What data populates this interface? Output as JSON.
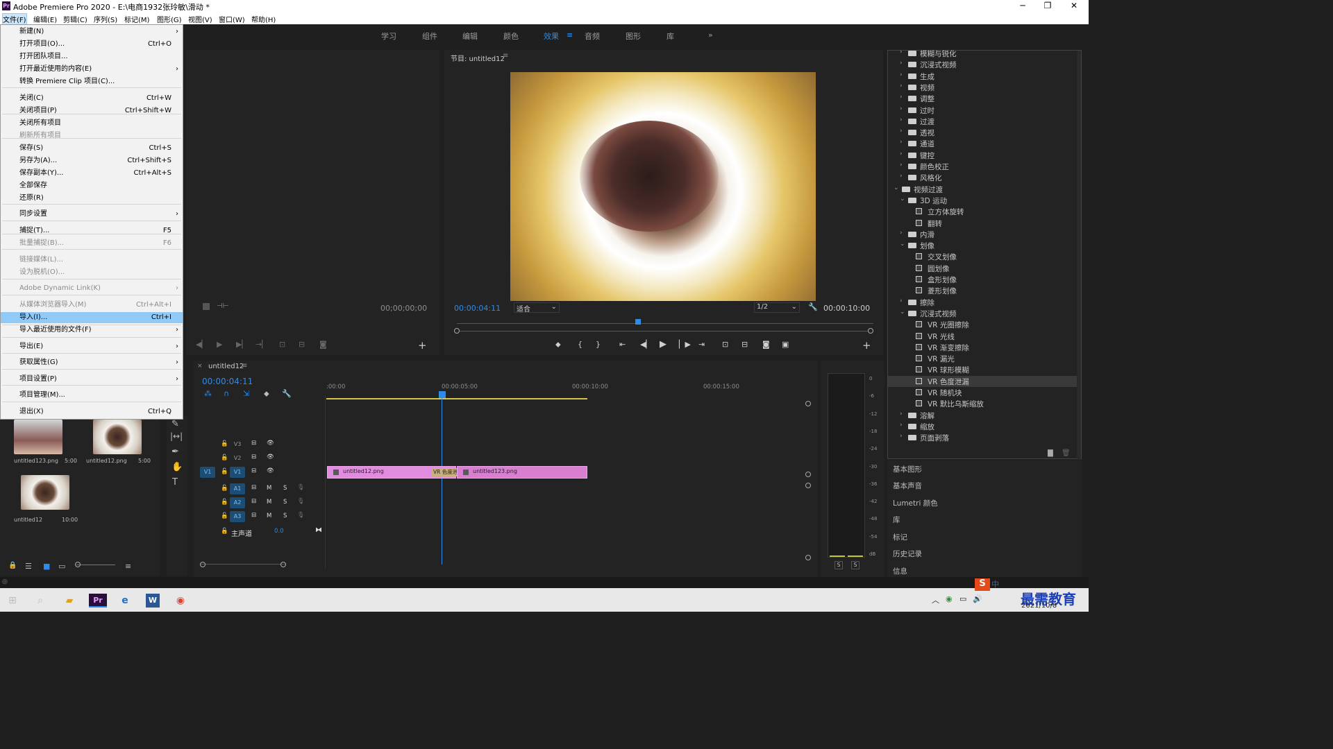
{
  "titlebar": {
    "app_icon": "Pr",
    "title": "Adobe Premiere Pro 2020 - E:\\电商1932张玲敏\\滑动 *"
  },
  "menubar": [
    "文件(F)",
    "编辑(E)",
    "剪辑(C)",
    "序列(S)",
    "标记(M)",
    "图形(G)",
    "视图(V)",
    "窗口(W)",
    "帮助(H)"
  ],
  "workspaces": [
    "学习",
    "组件",
    "编辑",
    "颜色",
    "效果",
    "音频",
    "图形",
    "库"
  ],
  "workspace_more": "»",
  "file_menu": [
    {
      "label": "新建(N)",
      "shortcut": "",
      "arrow": true
    },
    {
      "label": "打开项目(O)...",
      "shortcut": "Ctrl+O"
    },
    {
      "label": "打开团队项目..."
    },
    {
      "label": "打开最近使用的内容(E)",
      "arrow": true
    },
    {
      "label": "转换 Premiere Clip 项目(C)..."
    },
    {
      "label": "关闭(C)",
      "shortcut": "Ctrl+W"
    },
    {
      "label": "关闭项目(P)",
      "shortcut": "Ctrl+Shift+W"
    },
    {
      "label": "关闭所有项目"
    },
    {
      "label": "刷新所有项目",
      "disabled": true
    },
    {
      "label": "保存(S)",
      "shortcut": "Ctrl+S"
    },
    {
      "label": "另存为(A)...",
      "shortcut": "Ctrl+Shift+S"
    },
    {
      "label": "保存副本(Y)...",
      "shortcut": "Ctrl+Alt+S"
    },
    {
      "label": "全部保存"
    },
    {
      "label": "还原(R)"
    },
    {
      "label": "同步设置",
      "arrow": true
    },
    {
      "label": "捕捉(T)...",
      "shortcut": "F5"
    },
    {
      "label": "批量捕捉(B)...",
      "shortcut": "F6",
      "disabled": true
    },
    {
      "label": "链接媒体(L)...",
      "disabled": true
    },
    {
      "label": "设为脱机(O)...",
      "disabled": true
    },
    {
      "label": "Adobe Dynamic Link(K)",
      "arrow": true,
      "disabled": true
    },
    {
      "label": "从媒体浏览器导入(M)",
      "shortcut": "Ctrl+Alt+I",
      "disabled": true
    },
    {
      "label": "导入(I)...",
      "shortcut": "Ctrl+I",
      "highlight": true
    },
    {
      "label": "导入最近使用的文件(F)",
      "arrow": true
    },
    {
      "label": "导出(E)",
      "arrow": true
    },
    {
      "label": "获取属性(G)",
      "arrow": true
    },
    {
      "label": "项目设置(P)",
      "arrow": true
    },
    {
      "label": "项目管理(M)..."
    },
    {
      "label": "退出(X)",
      "shortcut": "Ctrl+Q"
    }
  ],
  "source_monitor": {
    "timecode": "00;00;00;00"
  },
  "program_monitor": {
    "title": "节目: untitled12",
    "timecode": "00:00:04:11",
    "fit": "适合",
    "resolution": "1/2",
    "duration": "00:00:10:00"
  },
  "effects_tree": [
    {
      "label": "模糊与锐化",
      "type": "folder",
      "level": 1,
      "open": false
    },
    {
      "label": "沉浸式视频",
      "type": "folder",
      "level": 1,
      "open": false
    },
    {
      "label": "生成",
      "type": "folder",
      "level": 1,
      "open": false
    },
    {
      "label": "视频",
      "type": "folder",
      "level": 1,
      "open": false
    },
    {
      "label": "调整",
      "type": "folder",
      "level": 1,
      "open": false
    },
    {
      "label": "过时",
      "type": "folder",
      "level": 1,
      "open": false
    },
    {
      "label": "过渡",
      "type": "folder",
      "level": 1,
      "open": false
    },
    {
      "label": "透视",
      "type": "folder",
      "level": 1,
      "open": false
    },
    {
      "label": "通道",
      "type": "folder",
      "level": 1,
      "open": false
    },
    {
      "label": "键控",
      "type": "folder",
      "level": 1,
      "open": false
    },
    {
      "label": "颜色校正",
      "type": "folder",
      "level": 1,
      "open": false
    },
    {
      "label": "风格化",
      "type": "folder",
      "level": 1,
      "open": false
    },
    {
      "label": "视频过渡",
      "type": "folder",
      "level": 0,
      "open": true
    },
    {
      "label": "3D 运动",
      "type": "folder",
      "level": 1,
      "open": true
    },
    {
      "label": "立方体旋转",
      "type": "fx",
      "level": 2
    },
    {
      "label": "翻转",
      "type": "fx",
      "level": 2
    },
    {
      "label": "内滑",
      "type": "folder",
      "level": 1,
      "open": false
    },
    {
      "label": "划像",
      "type": "folder",
      "level": 1,
      "open": true
    },
    {
      "label": "交叉划像",
      "type": "fx",
      "level": 2
    },
    {
      "label": "圆划像",
      "type": "fx",
      "level": 2
    },
    {
      "label": "盒形划像",
      "type": "fx",
      "level": 2
    },
    {
      "label": "菱形划像",
      "type": "fx",
      "level": 2
    },
    {
      "label": "擦除",
      "type": "folder",
      "level": 1,
      "open": false
    },
    {
      "label": "沉浸式视频",
      "type": "folder",
      "level": 1,
      "open": true
    },
    {
      "label": "VR 光圈擦除",
      "type": "fx",
      "level": 2
    },
    {
      "label": "VR 光线",
      "type": "fx",
      "level": 2
    },
    {
      "label": "VR 渐变擦除",
      "type": "fx",
      "level": 2
    },
    {
      "label": "VR 漏光",
      "type": "fx",
      "level": 2
    },
    {
      "label": "VR 球形模糊",
      "type": "fx",
      "level": 2
    },
    {
      "label": "VR 色度泄漏",
      "type": "fx",
      "level": 2,
      "selected": true
    },
    {
      "label": "VR 随机块",
      "type": "fx",
      "level": 2
    },
    {
      "label": "VR 默比乌斯缩放",
      "type": "fx",
      "level": 2
    },
    {
      "label": "溶解",
      "type": "folder",
      "level": 1,
      "open": false
    },
    {
      "label": "缩放",
      "type": "folder",
      "level": 1,
      "open": false
    },
    {
      "label": "页面剥落",
      "type": "folder",
      "level": 1,
      "open": false
    }
  ],
  "right_panels": [
    "基本图形",
    "基本声音",
    "Lumetri 颜色",
    "库",
    "标记",
    "历史记录",
    "信息"
  ],
  "project_items": [
    {
      "name": "untitled123.png",
      "duration": "5:00"
    },
    {
      "name": "untitled12.png",
      "duration": "5:00"
    },
    {
      "name": "untitled12",
      "duration": "10:00"
    }
  ],
  "timeline": {
    "tab": "untitled12",
    "timecode": "00:00:04:11",
    "ruler": [
      ":00:00",
      "00:00:05:00",
      "00:00:10:00",
      "00:00:15:00"
    ],
    "video_tracks": [
      "V3",
      "V2",
      "V1"
    ],
    "source_patch": "V1",
    "audio_tracks": [
      "A1",
      "A2",
      "A3"
    ],
    "mix_label": "主声道",
    "mix_value": "0.0",
    "clips": [
      {
        "name": "untitled12.png",
        "transition": "VR 色度泄"
      },
      {
        "name": "untitled123.png"
      }
    ],
    "m_label": "M",
    "s_label": "S"
  },
  "audio_meter": {
    "scale": [
      "0",
      "-6",
      "-12",
      "-18",
      "-24",
      "-30",
      "-36",
      "-42",
      "-48",
      "-54",
      "dB"
    ],
    "solo": [
      "S",
      "S"
    ]
  },
  "taskbar": {
    "date": "2021/10/8",
    "ime": "中",
    "watermark": "最需教育"
  }
}
